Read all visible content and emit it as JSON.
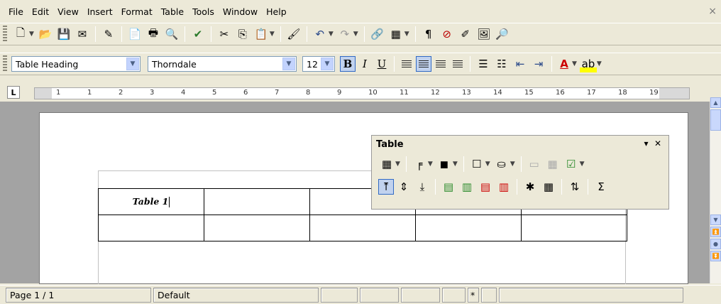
{
  "menu": {
    "items": [
      "File",
      "Edit",
      "View",
      "Insert",
      "Format",
      "Table",
      "Tools",
      "Window",
      "Help"
    ],
    "close": "×"
  },
  "format": {
    "style": "Table Heading",
    "font": "Thorndale",
    "size": "12",
    "bold": "B",
    "italic": "I",
    "underline": "U",
    "font_color_glyph": "A"
  },
  "ruler": {
    "numbers": [
      "1",
      "1",
      "2",
      "3",
      "4",
      "5",
      "6",
      "7",
      "8",
      "9",
      "10",
      "11",
      "12",
      "13",
      "14",
      "15",
      "16",
      "17",
      "18",
      "19"
    ]
  },
  "table_toolbar": {
    "title": "Table",
    "sum": "Σ"
  },
  "document": {
    "table": {
      "rows": [
        [
          "Table 1",
          "",
          "",
          "",
          ""
        ],
        [
          "",
          "",
          "",
          "",
          ""
        ]
      ]
    }
  },
  "status": {
    "page": "Page 1 / 1",
    "style": "Default",
    "modified": "*"
  }
}
